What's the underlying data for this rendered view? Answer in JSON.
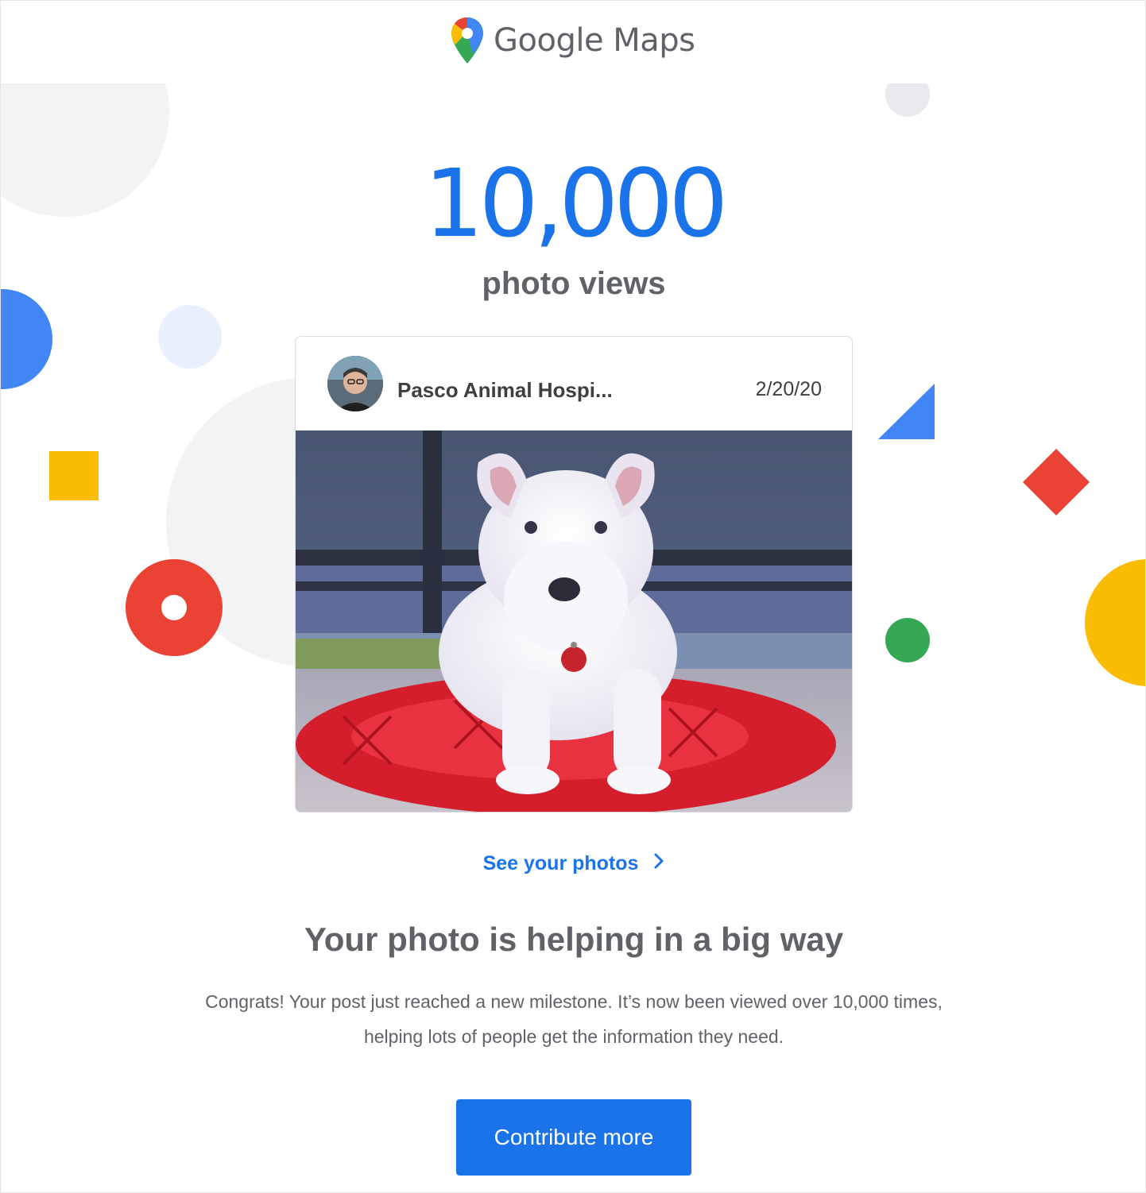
{
  "header": {
    "logo_text": "Google Maps",
    "logo_icon": "map-pin-icon"
  },
  "milestone": {
    "count": "10,000",
    "label": "photo views"
  },
  "card": {
    "place_name": "Pasco Animal Hospi...",
    "date": "2/20/20",
    "avatar_icon": "user-avatar",
    "photo_icon": "dog-photo"
  },
  "link": {
    "label": "See your photos",
    "icon": "chevron-right-icon"
  },
  "message": {
    "heading": "Your photo is helping in a big way",
    "body_line1": "Congrats! Your post just reached a new milestone. It’s now been viewed over 10,000 times,",
    "body_line2": "helping lots of people get the information they need."
  },
  "cta": {
    "label": "Contribute more"
  },
  "colors": {
    "blue": "#4285f4",
    "red": "#ea4335",
    "yellow": "#fbbc04",
    "green": "#34a853",
    "link": "#1a73e8"
  }
}
